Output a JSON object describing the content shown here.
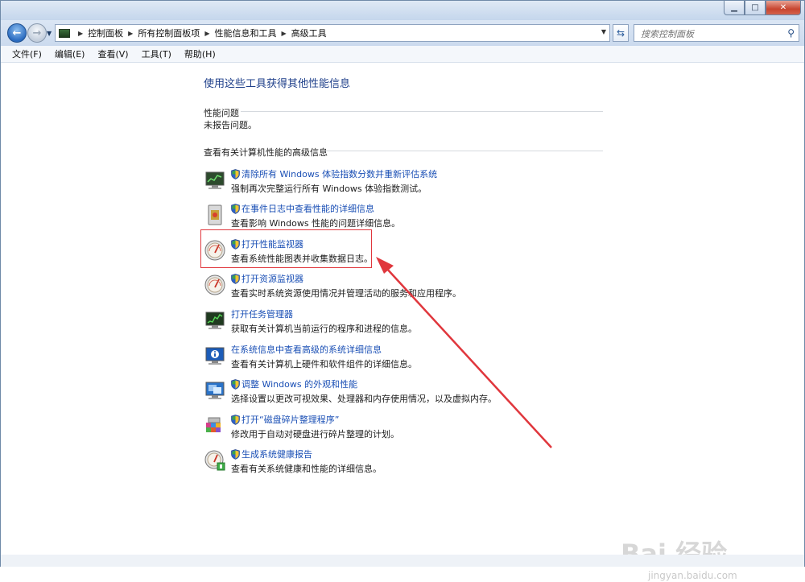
{
  "window": {
    "minimize_glyph": "▁",
    "maximize_glyph": "□",
    "close_glyph": "✕"
  },
  "nav": {
    "back_glyph": "←",
    "forward_glyph": "→",
    "breadcrumb": [
      "控制面板",
      "所有控制面板项",
      "性能信息和工具",
      "高级工具"
    ],
    "search_placeholder": "搜索控制面板"
  },
  "menu": {
    "items": [
      "文件(F)",
      "编辑(E)",
      "查看(V)",
      "工具(T)",
      "帮助(H)"
    ]
  },
  "main": {
    "heading": "使用这些工具获得其他性能信息",
    "perf_issues_label": "性能问题",
    "perf_issues_text": "未报告问题。",
    "advanced_label": "查看有关计算机性能的高级信息",
    "items": [
      {
        "icon": "monitor-chart-icon",
        "shield": true,
        "link": "清除所有 Windows 体验指数分数并重新评估系统",
        "desc": "强制再次完整运行所有 Windows 体验指数测试。"
      },
      {
        "icon": "event-log-icon",
        "shield": true,
        "link": "在事件日志中查看性能的详细信息",
        "desc": "查看影响 Windows 性能的问题详细信息。"
      },
      {
        "icon": "gauge-icon",
        "shield": true,
        "link": "打开性能监视器",
        "desc": "查看系统性能图表并收集数据日志。"
      },
      {
        "icon": "gauge-icon",
        "shield": true,
        "link": "打开资源监视器",
        "desc": "查看实时系统资源使用情况并管理活动的服务和应用程序。"
      },
      {
        "icon": "task-manager-icon",
        "shield": false,
        "link": "打开任务管理器",
        "desc": "获取有关计算机当前运行的程序和进程的信息。"
      },
      {
        "icon": "system-info-icon",
        "shield": false,
        "link": "在系统信息中查看高级的系统详细信息",
        "desc": "查看有关计算机上硬件和软件组件的详细信息。"
      },
      {
        "icon": "appearance-icon",
        "shield": true,
        "link": "调整 Windows 的外观和性能",
        "desc": "选择设置以更改可视效果、处理器和内存使用情况，以及虚拟内存。"
      },
      {
        "icon": "defrag-icon",
        "shield": true,
        "link": "打开“磁盘碎片整理程序”",
        "desc": "修改用于自动对硬盘进行碎片整理的计划。"
      },
      {
        "icon": "health-report-icon",
        "shield": true,
        "link": "生成系统健康报告",
        "desc": "查看有关系统健康和性能的详细信息。"
      }
    ]
  },
  "watermark": {
    "brand": "Bai 经验",
    "url": "jingyan.baidu.com"
  },
  "colors": {
    "link": "#1a4fb5",
    "highlight": "#e0373d"
  }
}
